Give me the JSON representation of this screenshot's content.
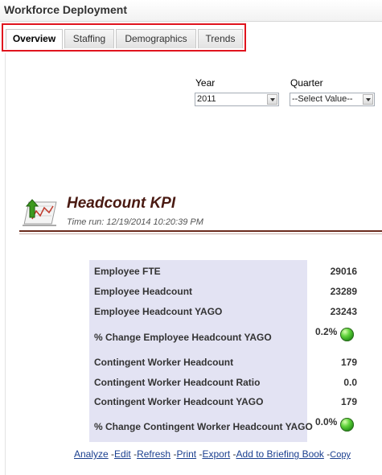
{
  "header": {
    "title": "Workforce Deployment"
  },
  "tabs": [
    {
      "label": "Overview",
      "active": true
    },
    {
      "label": "Staffing",
      "active": false
    },
    {
      "label": "Demographics",
      "active": false
    },
    {
      "label": "Trends",
      "active": false
    }
  ],
  "filters": {
    "year": {
      "label": "Year",
      "value": "2011"
    },
    "quarter": {
      "label": "Quarter",
      "value": "--Select Value--"
    }
  },
  "report": {
    "icon": "chart-arrow-icon",
    "title": "Headcount KPI",
    "time_run": "Time run: 12/19/2014 10:20:39 PM"
  },
  "kpis": [
    {
      "label": "Employee FTE",
      "value": "29016"
    },
    {
      "label": "Employee Headcount",
      "value": "23289"
    },
    {
      "label": "Employee Headcount YAGO",
      "value": "23243"
    },
    {
      "label": "% Change Employee Headcount YAGO",
      "value": "0.2%",
      "status": "green"
    },
    {
      "label": "Contingent Worker Headcount",
      "value": "179"
    },
    {
      "label": "Contingent Worker Headcount Ratio",
      "value": "0.0"
    },
    {
      "label": "Contingent Worker Headcount YAGO",
      "value": "179"
    },
    {
      "label": "% Change Contingent Worker Headcount YAGO",
      "value": "0.0%",
      "status": "green"
    }
  ],
  "links": {
    "analyze": "Analyze",
    "edit": "Edit",
    "refresh": "Refresh",
    "print": "Print",
    "export": "Export",
    "briefing": "Add to Briefing Book",
    "copy": "Copy",
    "separator": " -"
  },
  "colors": {
    "tab_highlight": "#e0141e",
    "kpi_title": "#4a1a12",
    "table_bg": "#e3e3f3",
    "status_green": "#3cbf28",
    "link": "#1a3f8f"
  }
}
